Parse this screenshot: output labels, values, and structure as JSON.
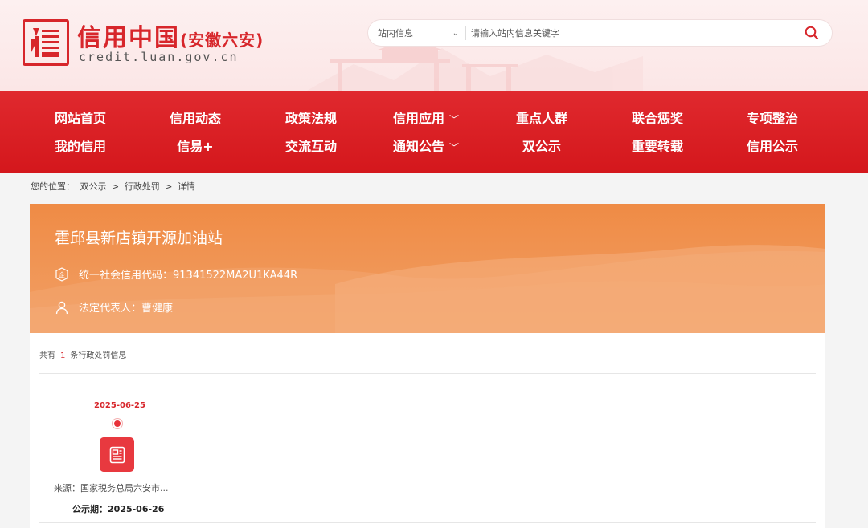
{
  "header": {
    "title": "信用中国",
    "subtitle": "(安徽六安)",
    "url": "credit.luan.gov.cn",
    "search": {
      "scope": "站内信息",
      "placeholder": "请输入站内信息关键字"
    }
  },
  "nav": {
    "row1": [
      {
        "label": "网站首页",
        "dropdown": false
      },
      {
        "label": "信用动态",
        "dropdown": false
      },
      {
        "label": "政策法规",
        "dropdown": false
      },
      {
        "label": "信用应用",
        "dropdown": true
      },
      {
        "label": "重点人群",
        "dropdown": false
      },
      {
        "label": "联合惩奖",
        "dropdown": false
      },
      {
        "label": "专项整治",
        "dropdown": false
      }
    ],
    "row2": [
      {
        "label": "我的信用",
        "dropdown": false
      },
      {
        "label": "信易+",
        "dropdown": false
      },
      {
        "label": "交流互动",
        "dropdown": false
      },
      {
        "label": "通知公告",
        "dropdown": true
      },
      {
        "label": "双公示",
        "dropdown": false
      },
      {
        "label": "重要转载",
        "dropdown": false
      },
      {
        "label": "信用公示",
        "dropdown": false
      }
    ]
  },
  "breadcrumb": {
    "prefix": "您的位置：",
    "items": [
      "双公示",
      "行政处罚",
      "详情"
    ],
    "sep": ">"
  },
  "entity": {
    "name": "霍邱县新店镇开源加油站",
    "code_label": "统一社会信用代码：91341522MA2U1KA44R",
    "rep_label": "法定代表人：曹健康"
  },
  "records": {
    "total_prefix": "共有",
    "total_count": "1",
    "total_suffix": "条行政处罚信息",
    "items": [
      {
        "date": "2025-06-25",
        "source": "来源：国家税务总局六安市...",
        "publish": "公示期：2025-06-26"
      }
    ]
  },
  "colors": {
    "primary": "#d7262b",
    "banner": "#ef8b45"
  }
}
